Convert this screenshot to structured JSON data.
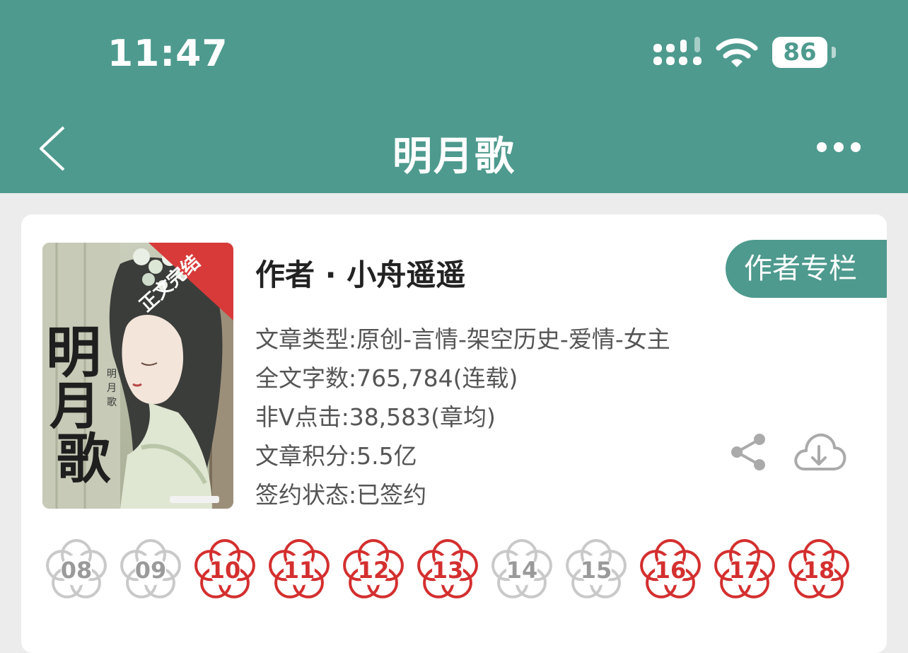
{
  "status_bar": {
    "time": "11:47",
    "battery": "86"
  },
  "nav": {
    "title": "明月歌"
  },
  "book": {
    "cover": {
      "badge": "正文完结",
      "title_large": [
        "明",
        "月",
        "歌"
      ],
      "title_small": [
        "明",
        "月",
        "歌"
      ]
    },
    "author_line": "作者 · 小舟遥遥",
    "author_column_button": "作者专栏",
    "info": [
      "文章类型:原创-言情-架空历史-爱情-女主",
      "全文字数:765,784(连载)",
      "非V点击:38,583(章均)",
      "文章积分:5.5亿",
      "签约状态:已签约"
    ]
  },
  "calendar_flowers": [
    {
      "day": "08",
      "active": false
    },
    {
      "day": "09",
      "active": false
    },
    {
      "day": "10",
      "active": true
    },
    {
      "day": "11",
      "active": true
    },
    {
      "day": "12",
      "active": true
    },
    {
      "day": "13",
      "active": true
    },
    {
      "day": "14",
      "active": false
    },
    {
      "day": "15",
      "active": false
    },
    {
      "day": "16",
      "active": true
    },
    {
      "day": "17",
      "active": true
    },
    {
      "day": "18",
      "active": true
    }
  ],
  "colors": {
    "header": "#4e9a8e",
    "flower_active": "#d42f2f",
    "flower_inactive": "#c9c9c9",
    "badge": "#d83a3a"
  },
  "icons": {
    "back": "chevron-left-icon",
    "more": "more-dots-icon",
    "signal": "cellular-signal-icon",
    "wifi": "wifi-icon",
    "battery": "battery-icon",
    "share": "share-icon",
    "download": "cloud-download-icon"
  }
}
